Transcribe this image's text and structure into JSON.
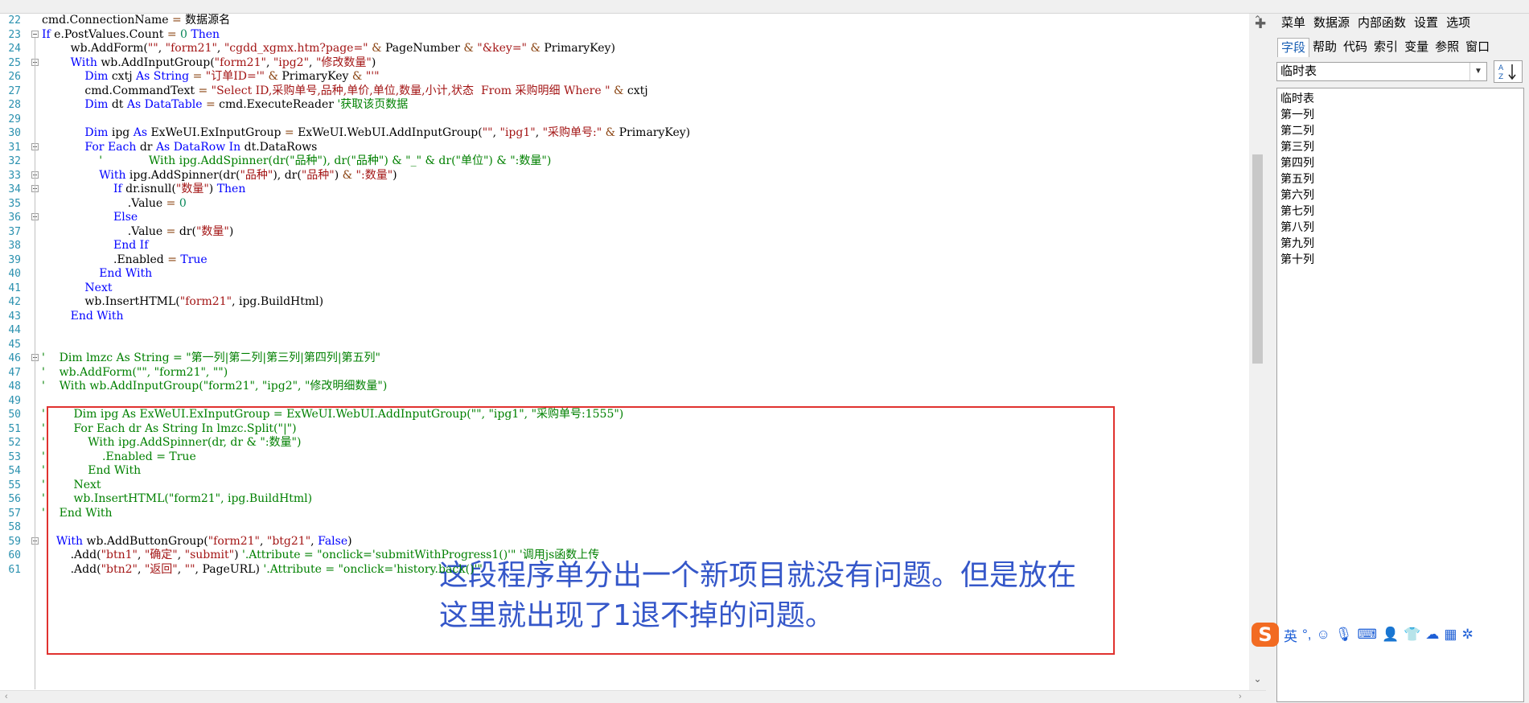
{
  "editor": {
    "lines": [
      {
        "n": "22",
        "text": "cmd.ConnectionName = 数据源名",
        "fold": false
      },
      {
        "n": "23",
        "text": "If e.PostValues.Count = 0 Then",
        "fold": true
      },
      {
        "n": "24",
        "text": "        wb.AddForm(\"\", \"form21\", \"cgdd_xgmx.htm?page=\" & PageNumber & \"&key=\" & PrimaryKey)",
        "fold": false
      },
      {
        "n": "25",
        "text": "        With wb.AddInputGroup(\"form21\", \"ipg2\", \"修改数量\")",
        "fold": true
      },
      {
        "n": "26",
        "text": "            Dim cxtj As String = \"订单ID='\" & PrimaryKey & \"'\"",
        "fold": false
      },
      {
        "n": "27",
        "text": "            cmd.CommandText = \"Select ID,采购单号,品种,单价,单位,数量,小计,状态  From 采购明细 Where \" & cxtj",
        "fold": false
      },
      {
        "n": "28",
        "text": "            Dim dt As DataTable = cmd.ExecuteReader '获取该页数据",
        "fold": false
      },
      {
        "n": "29",
        "text": "",
        "fold": false
      },
      {
        "n": "30",
        "text": "            Dim ipg As ExWeUI.ExInputGroup = ExWeUI.WebUI.AddInputGroup(\"\", \"ipg1\", \"采购单号:\" & PrimaryKey)",
        "fold": false
      },
      {
        "n": "31",
        "text": "            For Each dr As DataRow In dt.DataRows",
        "fold": true
      },
      {
        "n": "32",
        "text": "                '             With ipg.AddSpinner(dr(\"品种\"), dr(\"品种\") & \"_\" & dr(\"单位\") & \":数量\")",
        "fold": false
      },
      {
        "n": "33",
        "text": "                With ipg.AddSpinner(dr(\"品种\"), dr(\"品种\") & \":数量\")",
        "fold": true
      },
      {
        "n": "34",
        "text": "                    If dr.isnull(\"数量\") Then",
        "fold": true
      },
      {
        "n": "35",
        "text": "                        .Value = 0",
        "fold": false
      },
      {
        "n": "36",
        "text": "                    Else",
        "fold": true
      },
      {
        "n": "37",
        "text": "                        .Value = dr(\"数量\")",
        "fold": false
      },
      {
        "n": "38",
        "text": "                    End If",
        "fold": false
      },
      {
        "n": "39",
        "text": "                    .Enabled = True",
        "fold": false
      },
      {
        "n": "40",
        "text": "                End With",
        "fold": false
      },
      {
        "n": "41",
        "text": "            Next",
        "fold": false
      },
      {
        "n": "42",
        "text": "            wb.InsertHTML(\"form21\", ipg.BuildHtml)",
        "fold": false
      },
      {
        "n": "43",
        "text": "        End With",
        "fold": false
      },
      {
        "n": "44",
        "text": "",
        "fold": false
      },
      {
        "n": "45",
        "text": "",
        "fold": false
      },
      {
        "n": "46",
        "text": "'    Dim lmzc As String = \"第一列|第二列|第三列|第四列|第五列\"",
        "fold": true
      },
      {
        "n": "47",
        "text": "'    wb.AddForm(\"\", \"form21\", \"\")",
        "fold": false
      },
      {
        "n": "48",
        "text": "'    With wb.AddInputGroup(\"form21\", \"ipg2\", \"修改明细数量\")",
        "fold": false
      },
      {
        "n": "49",
        "text": "",
        "fold": false
      },
      {
        "n": "50",
        "text": "'        Dim ipg As ExWeUI.ExInputGroup = ExWeUI.WebUI.AddInputGroup(\"\", \"ipg1\", \"采购单号:1555\")",
        "fold": false
      },
      {
        "n": "51",
        "text": "'        For Each dr As String In lmzc.Split(\"|\")",
        "fold": false
      },
      {
        "n": "52",
        "text": "'            With ipg.AddSpinner(dr, dr & \":数量\")",
        "fold": false
      },
      {
        "n": "53",
        "text": "'                .Enabled = True",
        "fold": false
      },
      {
        "n": "54",
        "text": "'            End With",
        "fold": false
      },
      {
        "n": "55",
        "text": "'        Next",
        "fold": false
      },
      {
        "n": "56",
        "text": "'        wb.InsertHTML(\"form21\", ipg.BuildHtml)",
        "fold": false
      },
      {
        "n": "57",
        "text": "'    End With",
        "fold": false
      },
      {
        "n": "58",
        "text": "",
        "fold": false
      },
      {
        "n": "59",
        "text": "    With wb.AddButtonGroup(\"form21\", \"btg21\", False)",
        "fold": true
      },
      {
        "n": "60",
        "text": "        .Add(\"btn1\", \"确定\", \"submit\") '.Attribute = \"onclick='submitWithProgress1()'\" '调用js函数上传",
        "fold": false
      },
      {
        "n": "61",
        "text": "        .Add(\"btn2\", \"返回\", \"\", PageURL) '.Attribute = \"onclick='history.back()'\"",
        "fold": false
      }
    ],
    "annotation": "这段程序单分出一个新项目就没有问题。但是放在这里就出现了1退不掉的问题。"
  },
  "panel": {
    "menu": [
      "菜单",
      "数据源",
      "内部函数",
      "设置",
      "选项"
    ],
    "tabs": [
      "字段",
      "帮助",
      "代码",
      "索引",
      "变量",
      "参照",
      "窗口"
    ],
    "active_tab": "字段",
    "dropdown_value": "临时表",
    "list": [
      "临时表",
      "第一列",
      "第二列",
      "第三列",
      "第四列",
      "第五列",
      "第六列",
      "第七列",
      "第八列",
      "第九列",
      "第十列"
    ]
  },
  "ime": {
    "logo": "S",
    "mode": "英",
    "punct": "°,",
    "icons": [
      "emoji-icon",
      "mic-icon",
      "keyboard-icon",
      "user-icon",
      "skin-icon",
      "assistant-icon",
      "apps-icon",
      "settings-icon"
    ]
  },
  "colors": {
    "keyword": "#0000ff",
    "string": "#a31515",
    "comment": "#008000",
    "number": "#09885a",
    "line_number": "#2b91af",
    "annotation_box": "#e0322f",
    "annotation_text": "#3557c9"
  }
}
